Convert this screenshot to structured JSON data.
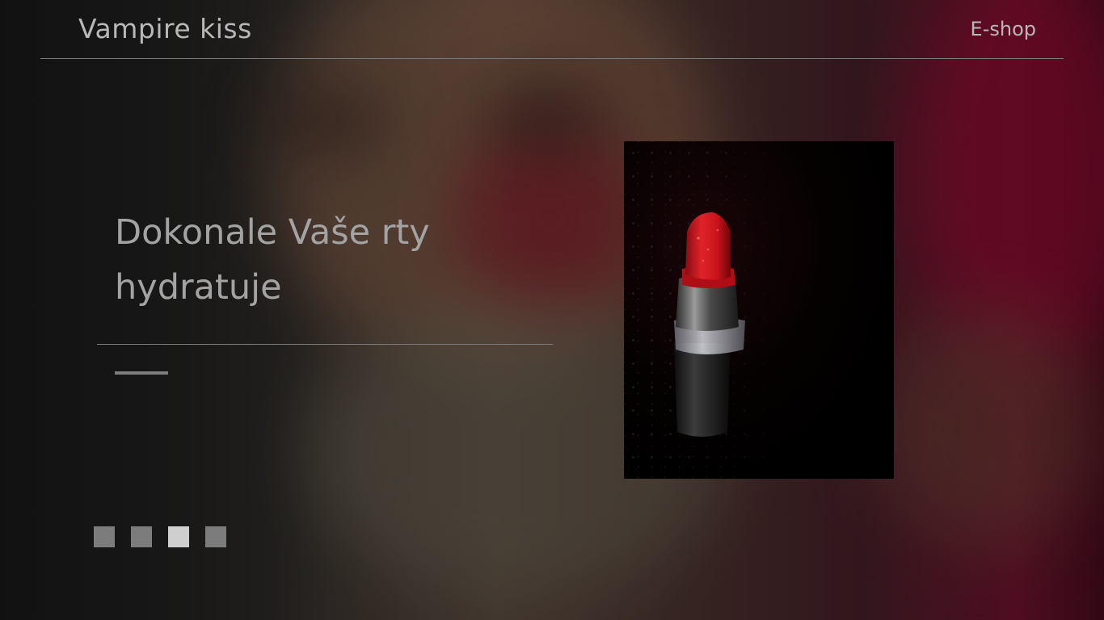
{
  "header": {
    "brand": "Vampire kiss",
    "nav_eshop": "E-shop"
  },
  "hero": {
    "headline_line1": "Dokonale Vaše rty",
    "headline_line2": "hydratuje"
  },
  "product_image": {
    "subject": "red lipstick",
    "lipstick_color": "#d8141c",
    "background_color": "#030303"
  },
  "slider": {
    "count": 4,
    "active_index": 2
  },
  "colors": {
    "text": "#b8b8b8",
    "rule": "#7a7a7a",
    "dot": "#7c7c7c",
    "dot_active": "#cfcfcf"
  }
}
